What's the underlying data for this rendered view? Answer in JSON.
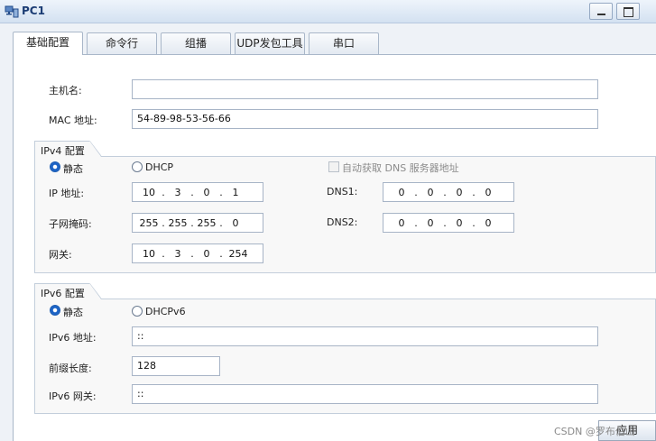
{
  "window": {
    "title": "PC1",
    "icon": "pc-icon"
  },
  "tabs": [
    {
      "label": "基础配置",
      "active": true
    },
    {
      "label": "命令行",
      "active": false
    },
    {
      "label": "组播",
      "active": false
    },
    {
      "label": "UDP发包工具",
      "active": false
    },
    {
      "label": "串口",
      "active": false
    }
  ],
  "basic": {
    "hostname_label": "主机名:",
    "hostname_value": "",
    "mac_label": "MAC 地址:",
    "mac_value": "54-89-98-53-56-66"
  },
  "ipv4": {
    "group_title": "IPv4 配置",
    "static_label": "静态",
    "dhcp_label": "DHCP",
    "mode": "static",
    "auto_dns_label": "自动获取 DNS 服务器地址",
    "auto_dns_checked": false,
    "ip_label": "IP 地址:",
    "ip": [
      "10",
      "3",
      "0",
      "1"
    ],
    "mask_label": "子网掩码:",
    "mask": [
      "255",
      "255",
      "255",
      "0"
    ],
    "gateway_label": "网关:",
    "gateway": [
      "10",
      "3",
      "0",
      "254"
    ],
    "dns1_label": "DNS1:",
    "dns1": [
      "0",
      "0",
      "0",
      "0"
    ],
    "dns2_label": "DNS2:",
    "dns2": [
      "0",
      "0",
      "0",
      "0"
    ]
  },
  "ipv6": {
    "group_title": "IPv6 配置",
    "static_label": "静态",
    "dhcp_label": "DHCPv6",
    "mode": "static",
    "addr_label": "IPv6 地址:",
    "addr_value": "::",
    "prefix_label": "前缀长度:",
    "prefix_value": "128",
    "gateway_label": "IPv6 网关:",
    "gateway_value": "::"
  },
  "footer": {
    "apply_label": "应用",
    "watermark": "CSDN @罗布伯山"
  },
  "colors": {
    "accent": "#1d64c6",
    "title_text": "#1b3c74",
    "panel_bg": "#ffffff"
  }
}
